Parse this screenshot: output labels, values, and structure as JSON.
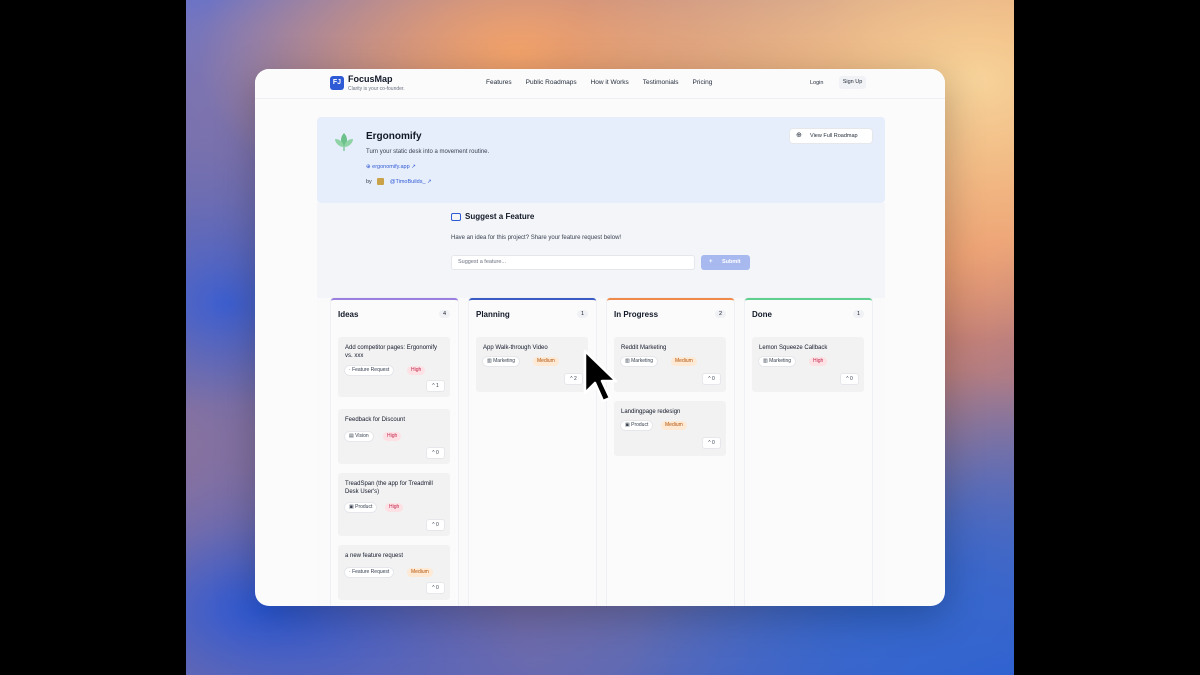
{
  "nav": {
    "logo_text": "FJ",
    "brand": "FocusMap",
    "tagline": "Clarity is your co-founder.",
    "links": [
      "Features",
      "Public Roadmaps",
      "How it Works",
      "Testimonials",
      "Pricing"
    ],
    "login": "Login",
    "signup": "Sign Up"
  },
  "project": {
    "name": "Ergonomify",
    "description": "Turn your static desk into a movement routine.",
    "url": "ergonomify.app",
    "by_label": "by",
    "handle": "@TimoBuilds_",
    "view_button": "View Full Roadmap"
  },
  "suggest": {
    "title": "Suggest a Feature",
    "description": "Have an idea for this project? Share your feature request below!",
    "placeholder": "Suggest a feature...",
    "submit": "Submit"
  },
  "columns": [
    {
      "title": "Ideas",
      "count": "4",
      "accent": "#9b7fe0",
      "cards": [
        {
          "title": "Add competitor pages: Ergonomify vs. xxx",
          "category": "Feature Request",
          "priority": "High",
          "votes": "1"
        },
        {
          "title": "Feedback for Discount",
          "category": "Vision",
          "priority": "High",
          "votes": "0"
        },
        {
          "title": "TreadSpan (the app for Treadmill Desk User's)",
          "category": "Product",
          "priority": "High",
          "votes": "0"
        },
        {
          "title": "a new feature request",
          "category": "Feature Request",
          "priority": "Medium",
          "votes": "0"
        }
      ]
    },
    {
      "title": "Planning",
      "count": "1",
      "accent": "#3b5bc4",
      "cards": [
        {
          "title": "App Walk-through Video",
          "category": "Marketing",
          "priority": "Medium",
          "votes": "2"
        }
      ]
    },
    {
      "title": "In Progress",
      "count": "2",
      "accent": "#f08a4b",
      "cards": [
        {
          "title": "Reddit Marketing",
          "category": "Marketing",
          "priority": "Medium",
          "votes": "0"
        },
        {
          "title": "Landingpage redesign",
          "category": "Product",
          "priority": "Medium",
          "votes": "0"
        }
      ]
    },
    {
      "title": "Done",
      "count": "1",
      "accent": "#5fcf8f",
      "cards": [
        {
          "title": "Lemon Squeeze Callback",
          "category": "Marketing",
          "priority": "High",
          "votes": "0"
        }
      ]
    }
  ],
  "icons": {
    "upvote": "chevron-up-icon",
    "globe": "globe-icon",
    "external": "external-link-icon"
  }
}
